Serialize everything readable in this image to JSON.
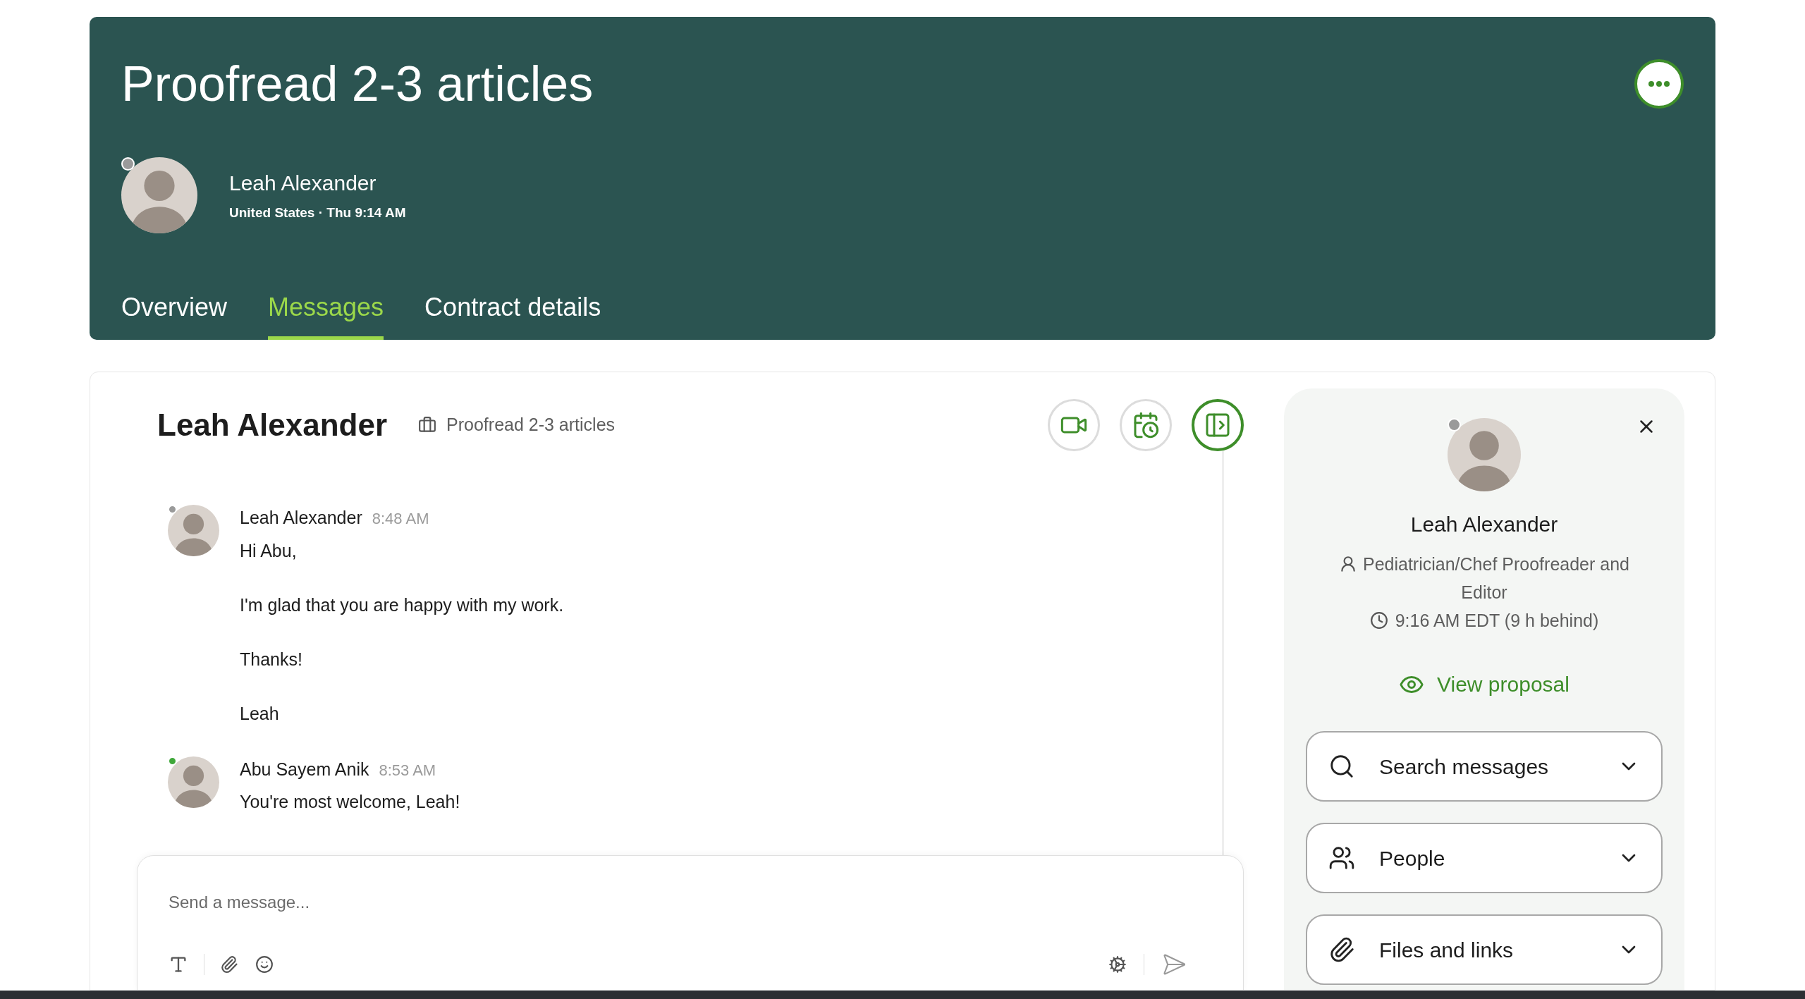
{
  "header": {
    "title": "Proofread 2-3 articles",
    "contact": {
      "name": "Leah Alexander",
      "online": false,
      "details": "United States · Thu 9:14 AM"
    }
  },
  "tabs": [
    {
      "label": "Overview",
      "selected": false
    },
    {
      "label": "Messages",
      "selected": true
    },
    {
      "label": "Contract details",
      "selected": false
    }
  ],
  "chat": {
    "title": "Leah Alexander",
    "contract": "Proofread 2-3 articles",
    "actions": [
      {
        "kind": "video",
        "on": false
      },
      {
        "kind": "schedule",
        "on": false
      },
      {
        "kind": "panel",
        "on": true
      }
    ],
    "messages": [
      {
        "sender": "Leah Alexander",
        "time": "8:48 AM",
        "online": false,
        "paragraphs": [
          "Hi Abu,",
          "I'm glad that you are happy with my work.",
          "Thanks!",
          "Leah"
        ]
      },
      {
        "sender": "Abu Sayem Anik",
        "time": "8:53 AM",
        "online": true,
        "paragraphs": [
          "You're most welcome, Leah!"
        ]
      }
    ],
    "composer": {
      "placeholder": "Send a message..."
    }
  },
  "profile": {
    "name": "Leah Alexander",
    "online": false,
    "role": "Pediatrician/Chef Proofreader and Editor",
    "local_time": "9:16 AM EDT (9 h behind)",
    "link": "View proposal",
    "sections": [
      {
        "kind": "search",
        "label": "Search messages"
      },
      {
        "kind": "people",
        "label": "People"
      },
      {
        "kind": "files",
        "label": "Files and links"
      }
    ]
  }
}
